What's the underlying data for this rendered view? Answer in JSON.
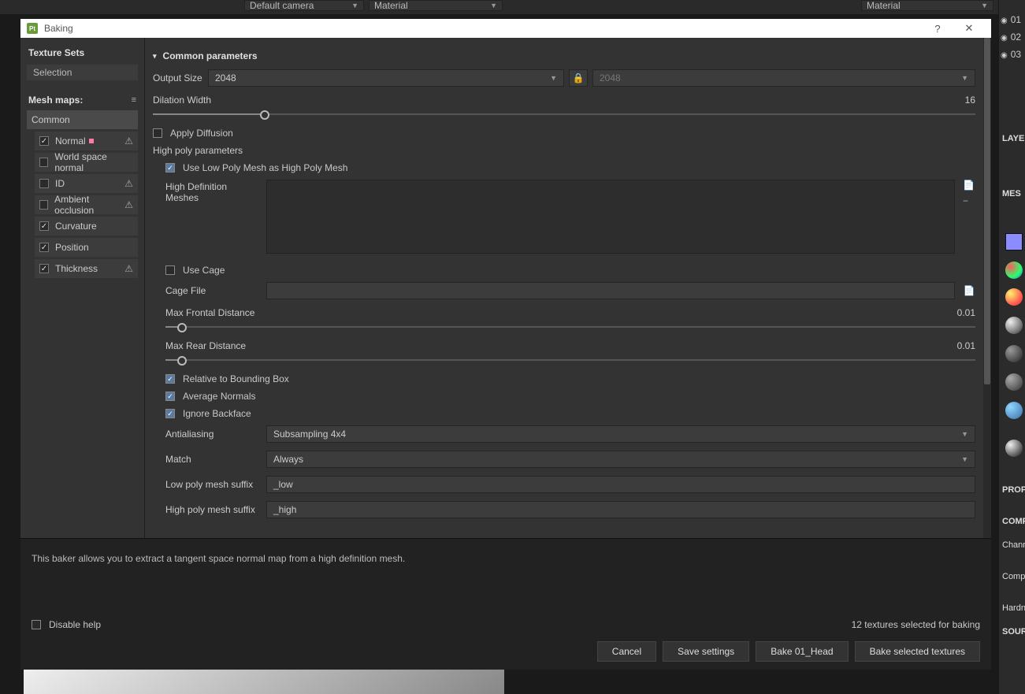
{
  "top_strip": {
    "camera_dd": "Default camera",
    "left_mode_dd": "Material",
    "right_mode_dd": "Material"
  },
  "dialog": {
    "title": "Baking"
  },
  "texture_sets": {
    "header": "Texture Sets",
    "selection_label": "Selection"
  },
  "mesh_maps": {
    "header": "Mesh maps:",
    "common": "Common",
    "items": [
      {
        "label": "Normal",
        "checked": true,
        "warn": true,
        "pink": true
      },
      {
        "label": "World space normal",
        "checked": false,
        "warn": false
      },
      {
        "label": "ID",
        "checked": false,
        "warn": true
      },
      {
        "label": "Ambient occlusion",
        "checked": false,
        "warn": true
      },
      {
        "label": "Curvature",
        "checked": true,
        "warn": false
      },
      {
        "label": "Position",
        "checked": true,
        "warn": false
      },
      {
        "label": "Thickness",
        "checked": true,
        "warn": true
      }
    ]
  },
  "common_params": {
    "header": "Common parameters",
    "output_size_label": "Output Size",
    "output_size_value": "2048",
    "output_size_locked": "2048",
    "dilation_label": "Dilation Width",
    "dilation_value": "16",
    "apply_diffusion": "Apply Diffusion",
    "highpoly_header": "High poly parameters",
    "use_low_as_high": "Use Low Poly Mesh as High Poly Mesh",
    "hd_meshes_label": "High Definition Meshes",
    "use_cage": "Use Cage",
    "cage_file_label": "Cage File",
    "cage_file_value": "",
    "max_frontal_label": "Max Frontal Distance",
    "max_frontal_value": "0.01",
    "max_rear_label": "Max Rear Distance",
    "max_rear_value": "0.01",
    "relative_bbox": "Relative to Bounding Box",
    "average_normals": "Average Normals",
    "ignore_backface": "Ignore Backface",
    "antialiasing_label": "Antialiasing",
    "antialiasing_value": "Subsampling 4x4",
    "match_label": "Match",
    "match_value": "Always",
    "low_suffix_label": "Low poly mesh suffix",
    "low_suffix_value": "_low",
    "high_suffix_label": "High poly mesh suffix",
    "high_suffix_value": "_high"
  },
  "footer": {
    "description": "This baker allows you to extract a tangent space normal map from a high definition mesh.",
    "disable_help": "Disable help",
    "status": "12 textures selected for baking",
    "btn_cancel": "Cancel",
    "btn_save": "Save settings",
    "btn_bake_set": "Bake 01_Head",
    "btn_bake_sel": "Bake selected textures"
  },
  "rside": {
    "rows": [
      "01",
      "02",
      "03"
    ],
    "layers_label": "LAYE",
    "mesh_label": "MES",
    "prop_label": "PROP",
    "comp_label": "COMP",
    "chan_label": "Chann",
    "compa_label": "Compa",
    "hardn_label": "Hardn",
    "sour_label": "SOUR"
  }
}
